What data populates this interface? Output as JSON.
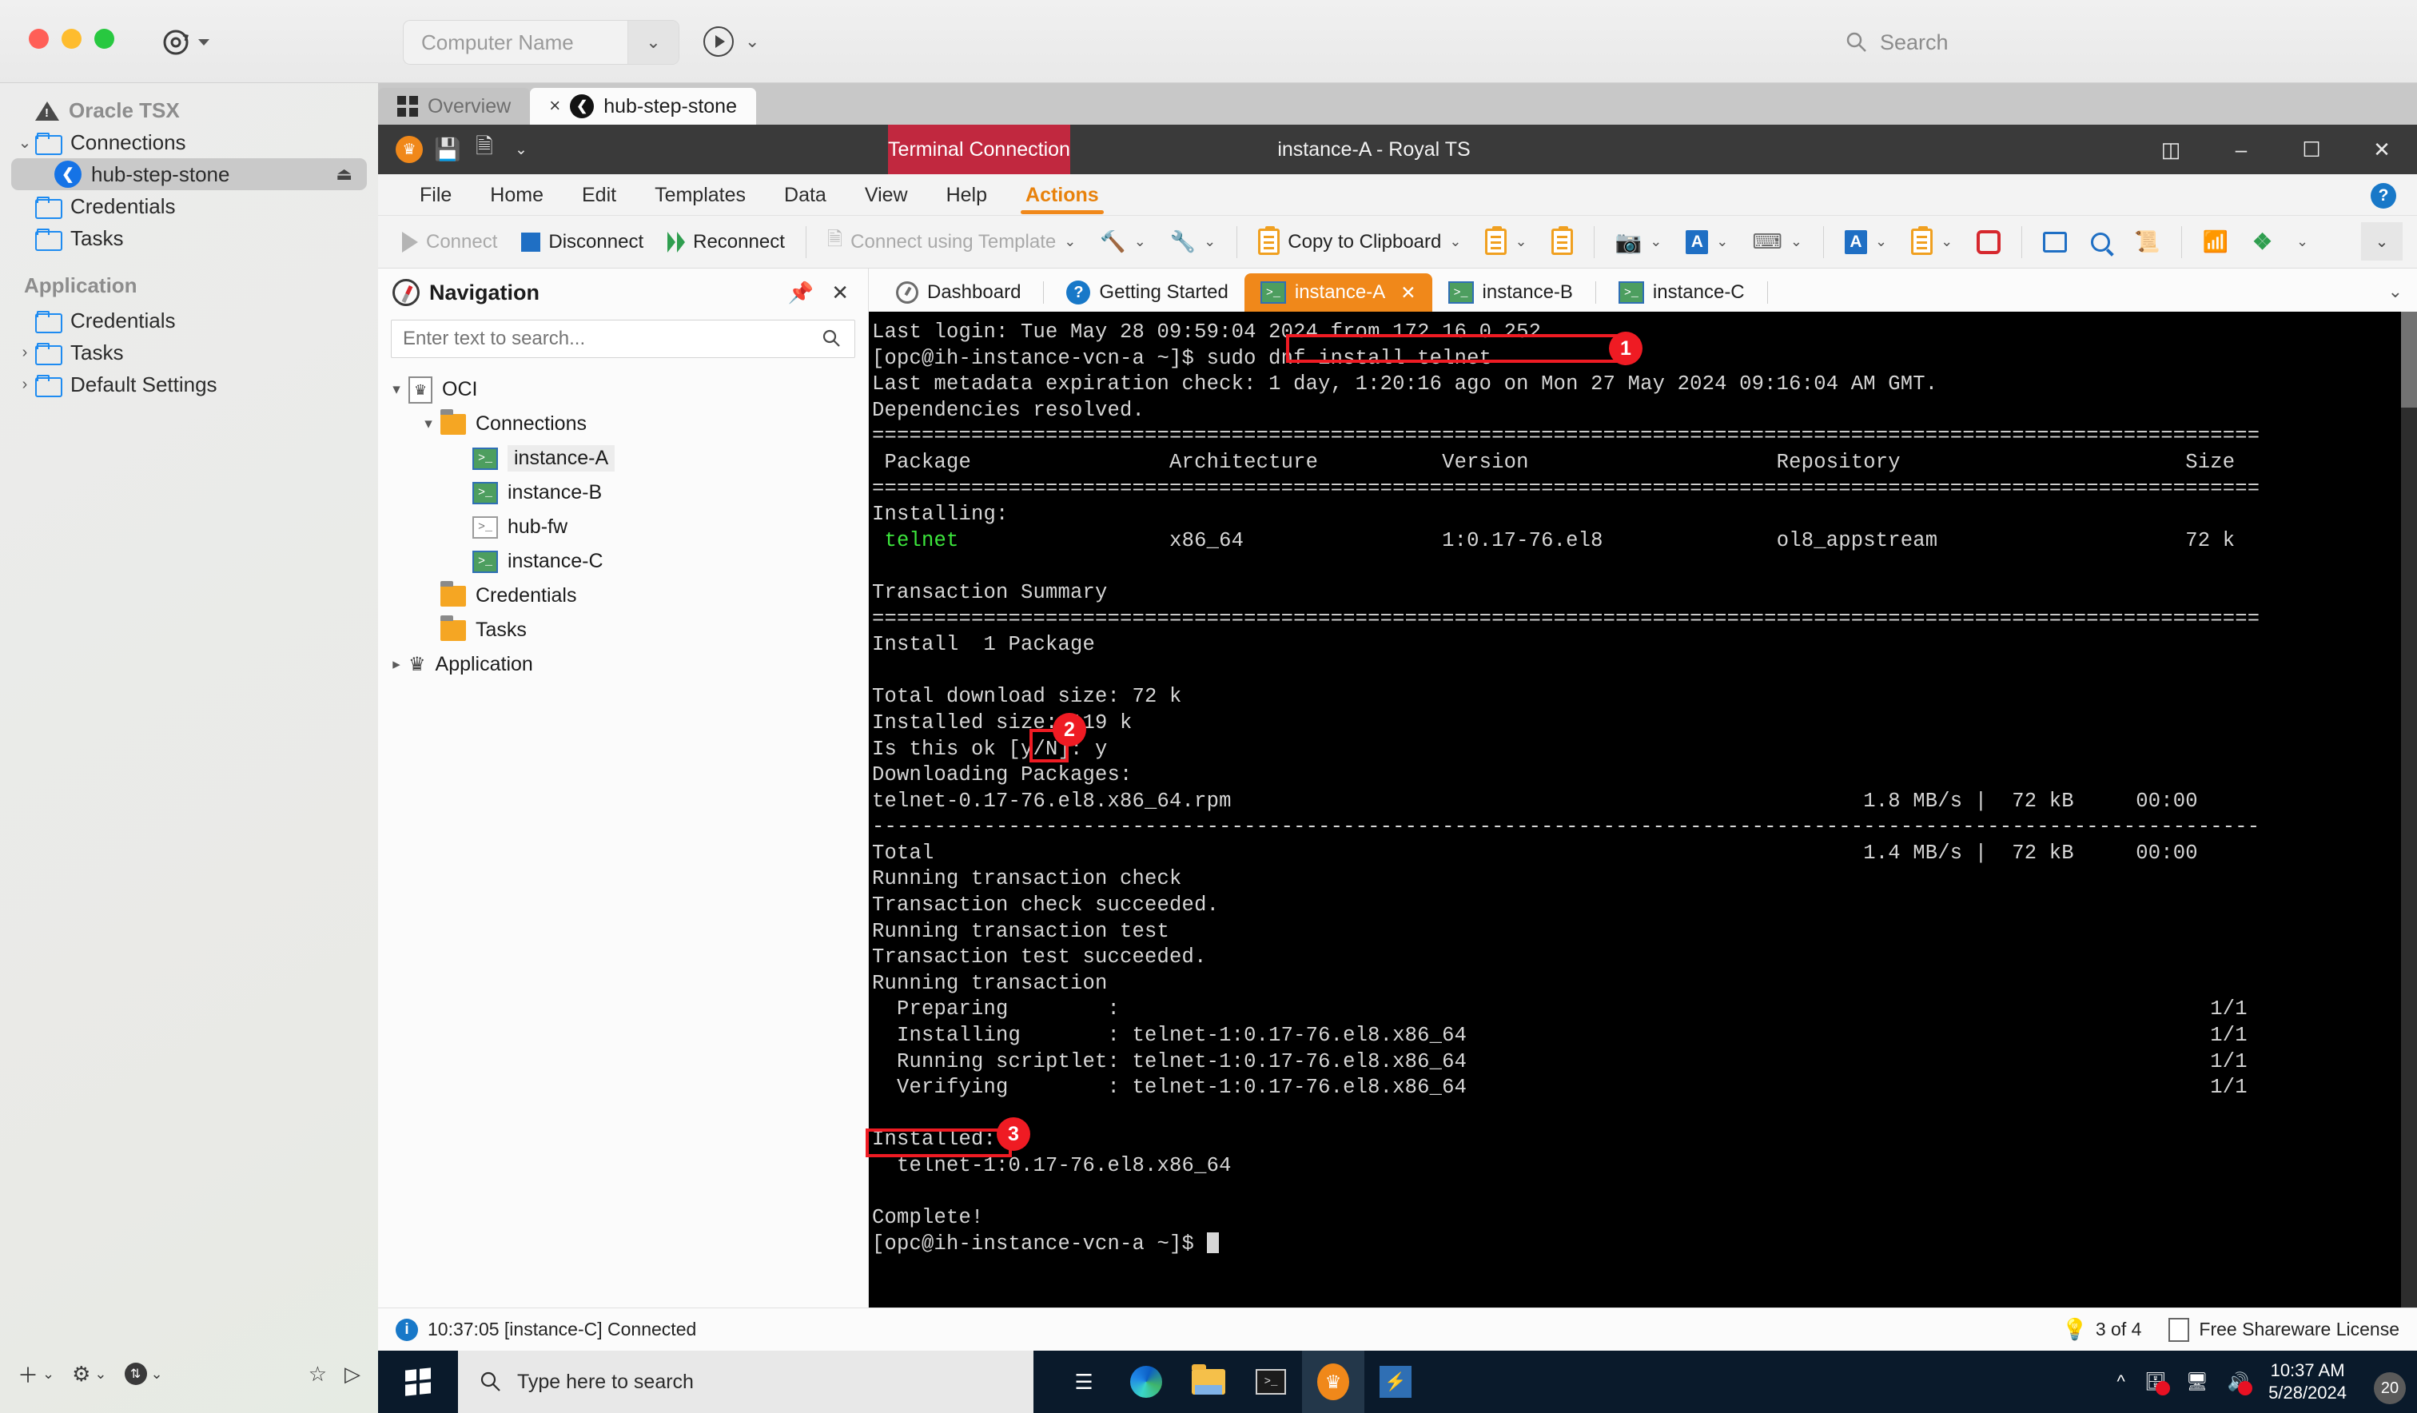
{
  "mac": {
    "toolbar": {
      "refresh_icon": "refresh-icon",
      "computer_name_placeholder": "Computer Name",
      "run_icon": "run-icon",
      "search_placeholder": "Search"
    },
    "sidebar": {
      "root_label": "Oracle TSX",
      "items": [
        {
          "label": "Connections",
          "icon": "folder-icon",
          "expanded": true
        },
        {
          "label": "hub-step-stone",
          "icon": "xshell-icon",
          "selected": true
        },
        {
          "label": "Credentials",
          "icon": "folder-icon"
        },
        {
          "label": "Tasks",
          "icon": "folder-icon"
        }
      ],
      "group_title": "Application",
      "app_items": [
        {
          "label": "Credentials",
          "icon": "folder-icon"
        },
        {
          "label": "Tasks",
          "icon": "folder-icon"
        },
        {
          "label": "Default Settings",
          "icon": "folder-icon"
        }
      ]
    },
    "bottom_bar": {
      "add_icon": "plus-icon",
      "settings_icon": "gear-icon",
      "transfer_icon": "transfer-icon",
      "favorite_icon": "star-icon",
      "play_icon": "play-icon"
    },
    "host_tabs": [
      {
        "label": "Overview",
        "icon": "grid-icon",
        "active": false
      },
      {
        "label": "hub-step-stone",
        "icon": "xshell-icon",
        "active": true,
        "close": "×"
      }
    ]
  },
  "royalts": {
    "titlebar": {
      "quick_access": [
        "crown-icon",
        "save-icon",
        "new-document-icon",
        "customize-icon"
      ],
      "connection_badge": "Terminal Connection",
      "window_title": "instance-A - Royal TS",
      "buttons": [
        "layout-icon",
        "minimize-icon",
        "maximize-icon",
        "close-icon"
      ]
    },
    "menu": [
      "File",
      "Home",
      "Edit",
      "Templates",
      "Data",
      "View",
      "Help",
      "Actions"
    ],
    "menu_active": "Actions",
    "help_icon": "help-icon",
    "ribbon": {
      "connect": "Connect",
      "disconnect": "Disconnect",
      "reconnect": "Reconnect",
      "connect_using_template": "Connect using Template",
      "copy_to_clipboard": "Copy to Clipboard",
      "icons": [
        "key-run-icon",
        "key-icon",
        "clipboard-text-icon",
        "clipboard-image-icon",
        "camera-icon",
        "font-star-icon",
        "keyboard-star-icon",
        "font-icon",
        "clipboard-icon",
        "stop-icon",
        "screen-off-icon",
        "find-icon",
        "log-icon",
        "broadcast-icon",
        "network-icon",
        "more-icon"
      ],
      "overflow_caret": "⌄"
    },
    "navigation": {
      "title": "Navigation",
      "icon": "compass-icon",
      "pin_icon": "pin-icon",
      "close_icon": "close-icon",
      "search_placeholder": "Enter text to search...",
      "search_value": "",
      "search_icon": "search-icon",
      "tree": [
        {
          "label": "OCI",
          "level": 0,
          "icon": "crown-document-icon",
          "twisty": "▾"
        },
        {
          "label": "Connections",
          "level": 1,
          "icon": "folder-icon",
          "twisty": "▾"
        },
        {
          "label": "instance-A",
          "level": 2,
          "icon": "terminal-icon",
          "selected": true
        },
        {
          "label": "instance-B",
          "level": 2,
          "icon": "terminal-icon"
        },
        {
          "label": "hub-fw",
          "level": 2,
          "icon": "terminal-off-icon"
        },
        {
          "label": "instance-C",
          "level": 2,
          "icon": "terminal-icon"
        },
        {
          "label": "Credentials",
          "level": 1,
          "icon": "folder-icon"
        },
        {
          "label": "Tasks",
          "level": 1,
          "icon": "folder-icon"
        },
        {
          "label": "Application",
          "level": 0,
          "icon": "crown-icon",
          "twisty": "▸"
        }
      ]
    },
    "document_tabs": [
      {
        "label": "Dashboard",
        "icon": "dashboard-icon",
        "active": false
      },
      {
        "label": "Getting Started",
        "icon": "question-icon",
        "active": false
      },
      {
        "label": "instance-A",
        "icon": "terminal-icon",
        "active": true,
        "close": "✕"
      },
      {
        "label": "instance-B",
        "icon": "terminal-icon",
        "active": false
      },
      {
        "label": "instance-C",
        "icon": "terminal-icon",
        "active": false
      }
    ],
    "tabs_overflow_icon": "chevron-down-icon",
    "status": {
      "info_icon": "info-icon",
      "message": "10:37:05 [instance-C] Connected",
      "tip_icon": "bulb-icon",
      "tip_count": "3 of 4",
      "license_icon": "license-icon",
      "license": "Free Shareware License"
    }
  },
  "terminal": {
    "prompt": "[opc@ih-instance-vcn-a ~]$",
    "lines": [
      "Last login: Tue May 28 09:59:04 2024 from 172.16.0.252",
      "[opc@ih-instance-vcn-a ~]$ sudo dnf install telnet",
      "Last metadata expiration check: 1 day, 1:20:16 ago on Mon 27 May 2024 09:16:04 AM GMT.",
      "Dependencies resolved.",
      "================================================================================================================",
      " Package                Architecture          Version                    Repository                       Size",
      "================================================================================================================",
      "Installing:",
      " telnet                 x86_64                1:0.17-76.el8              ol8_appstream                    72 k",
      "",
      "Transaction Summary",
      "================================================================================================================",
      "Install  1 Package",
      "",
      "Total download size: 72 k",
      "Installed size: 119 k",
      "Is this ok [y/N]: y",
      "Downloading Packages:",
      "telnet-0.17-76.el8.x86_64.rpm                                                   1.8 MB/s |  72 kB     00:00",
      "----------------------------------------------------------------------------------------------------------------",
      "Total                                                                           1.4 MB/s |  72 kB     00:00",
      "Running transaction check",
      "Transaction check succeeded.",
      "Running transaction test",
      "Transaction test succeeded.",
      "Running transaction",
      "  Preparing        :                                                                                        1/1",
      "  Installing       : telnet-1:0.17-76.el8.x86_64                                                            1/1",
      "  Running scriptlet: telnet-1:0.17-76.el8.x86_64                                                            1/1",
      "  Verifying        : telnet-1:0.17-76.el8.x86_64                                                            1/1",
      "",
      "Installed:",
      "  telnet-1:0.17-76.el8.x86_64",
      "",
      "Complete!",
      "[opc@ih-instance-vcn-a ~]$ "
    ],
    "green_token": "telnet",
    "callouts": [
      {
        "number": "1",
        "target": "sudo dnf install telnet"
      },
      {
        "number": "2",
        "target": "y"
      },
      {
        "number": "3",
        "target": "Complete!"
      }
    ],
    "colors": {
      "background": "#000000",
      "foreground": "#d6d6d6",
      "green": "#3ce63c",
      "callout": "#ef1b23"
    }
  },
  "windows_taskbar": {
    "start_icon": "windows-start-icon",
    "search_placeholder": "Type here to search",
    "search_icon": "search-icon",
    "pinned": [
      "task-view-icon",
      "edge-icon",
      "file-explorer-icon",
      "command-prompt-icon",
      "royalts-icon",
      "xshell-icon"
    ],
    "tray": {
      "overflow_icon": "chevron-up-icon",
      "icons": [
        "screen-share-icon",
        "display-icon",
        "volume-muted-icon"
      ],
      "time": "10:37 AM",
      "date": "5/28/2024",
      "notification_count": "20"
    }
  }
}
